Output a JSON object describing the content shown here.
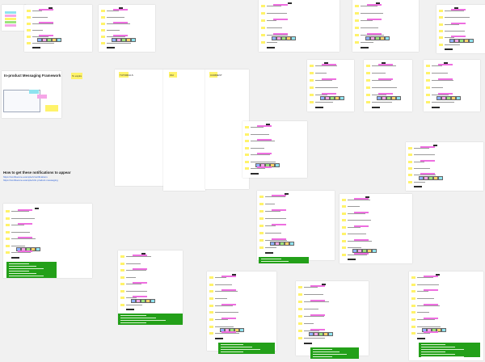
{
  "canvas": {
    "background": "#f1f1f1",
    "accent_yellow": "#fff36a",
    "accent_pink": "#f6a6e7",
    "accent_green": "#23a019",
    "accent_cyan": "#8fe3ef"
  },
  "labels": {
    "framework_title": "In-product Messaging Framework",
    "how_to_title": "How to get these notifications to appear",
    "sticky_1": "To expire",
    "sticky_2": "TUTORIALS",
    "sticky_3": "Old",
    "sticky_4": "CURRENT",
    "sticky_5": "Old version",
    "section_label": "Announcement"
  },
  "how_to_links": [
    "https://confluence.example/x/notifications",
    "https://confluence.example/x/in-product-messaging"
  ]
}
